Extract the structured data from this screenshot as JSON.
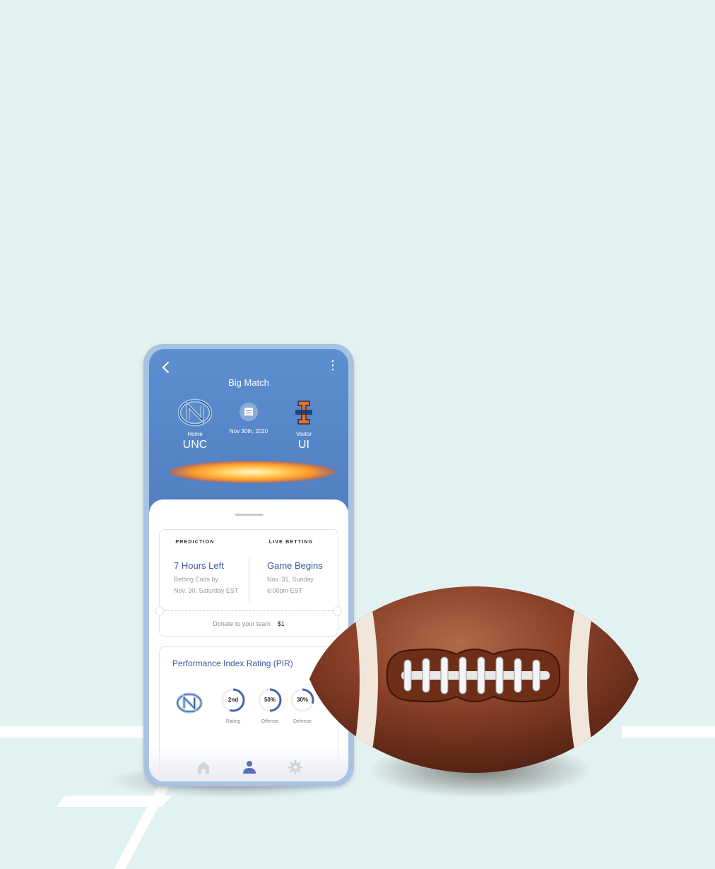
{
  "header": {
    "title": "Big Match"
  },
  "match": {
    "home": {
      "role": "Home",
      "abbr": "UNC"
    },
    "visitor": {
      "role": "Visitor",
      "abbr": "UI"
    },
    "date": "Nov 30th, 2020"
  },
  "prediction": {
    "heading": "PREDICTION",
    "status": "7 Hours Left",
    "detail_line1": "Betting Ends by",
    "detail_line2": "Nov. 30, Saturday EST"
  },
  "live_betting": {
    "heading": "LIVE BETTING",
    "status": "Game Begins",
    "detail_line1": "Nov. 31, Sunday",
    "detail_line2": "6:00pm EST"
  },
  "donate": {
    "label": "Donate to your team",
    "amount": "$1"
  },
  "pir": {
    "title": "Performance Index Rating (PIR)",
    "stats": [
      {
        "value": "2nd",
        "label": "Rating",
        "fill": 0.55
      },
      {
        "value": "50%",
        "label": "Offense",
        "fill": 0.5
      },
      {
        "value": "30%",
        "label": "Defense",
        "fill": 0.3
      }
    ]
  },
  "nav": {
    "items": [
      "home-icon",
      "profile-icon",
      "settings-icon"
    ],
    "active": "profile-icon"
  },
  "colors": {
    "accent": "#3b55a5",
    "header_blue": "#5a86c6",
    "background": "#e2f1f1"
  }
}
